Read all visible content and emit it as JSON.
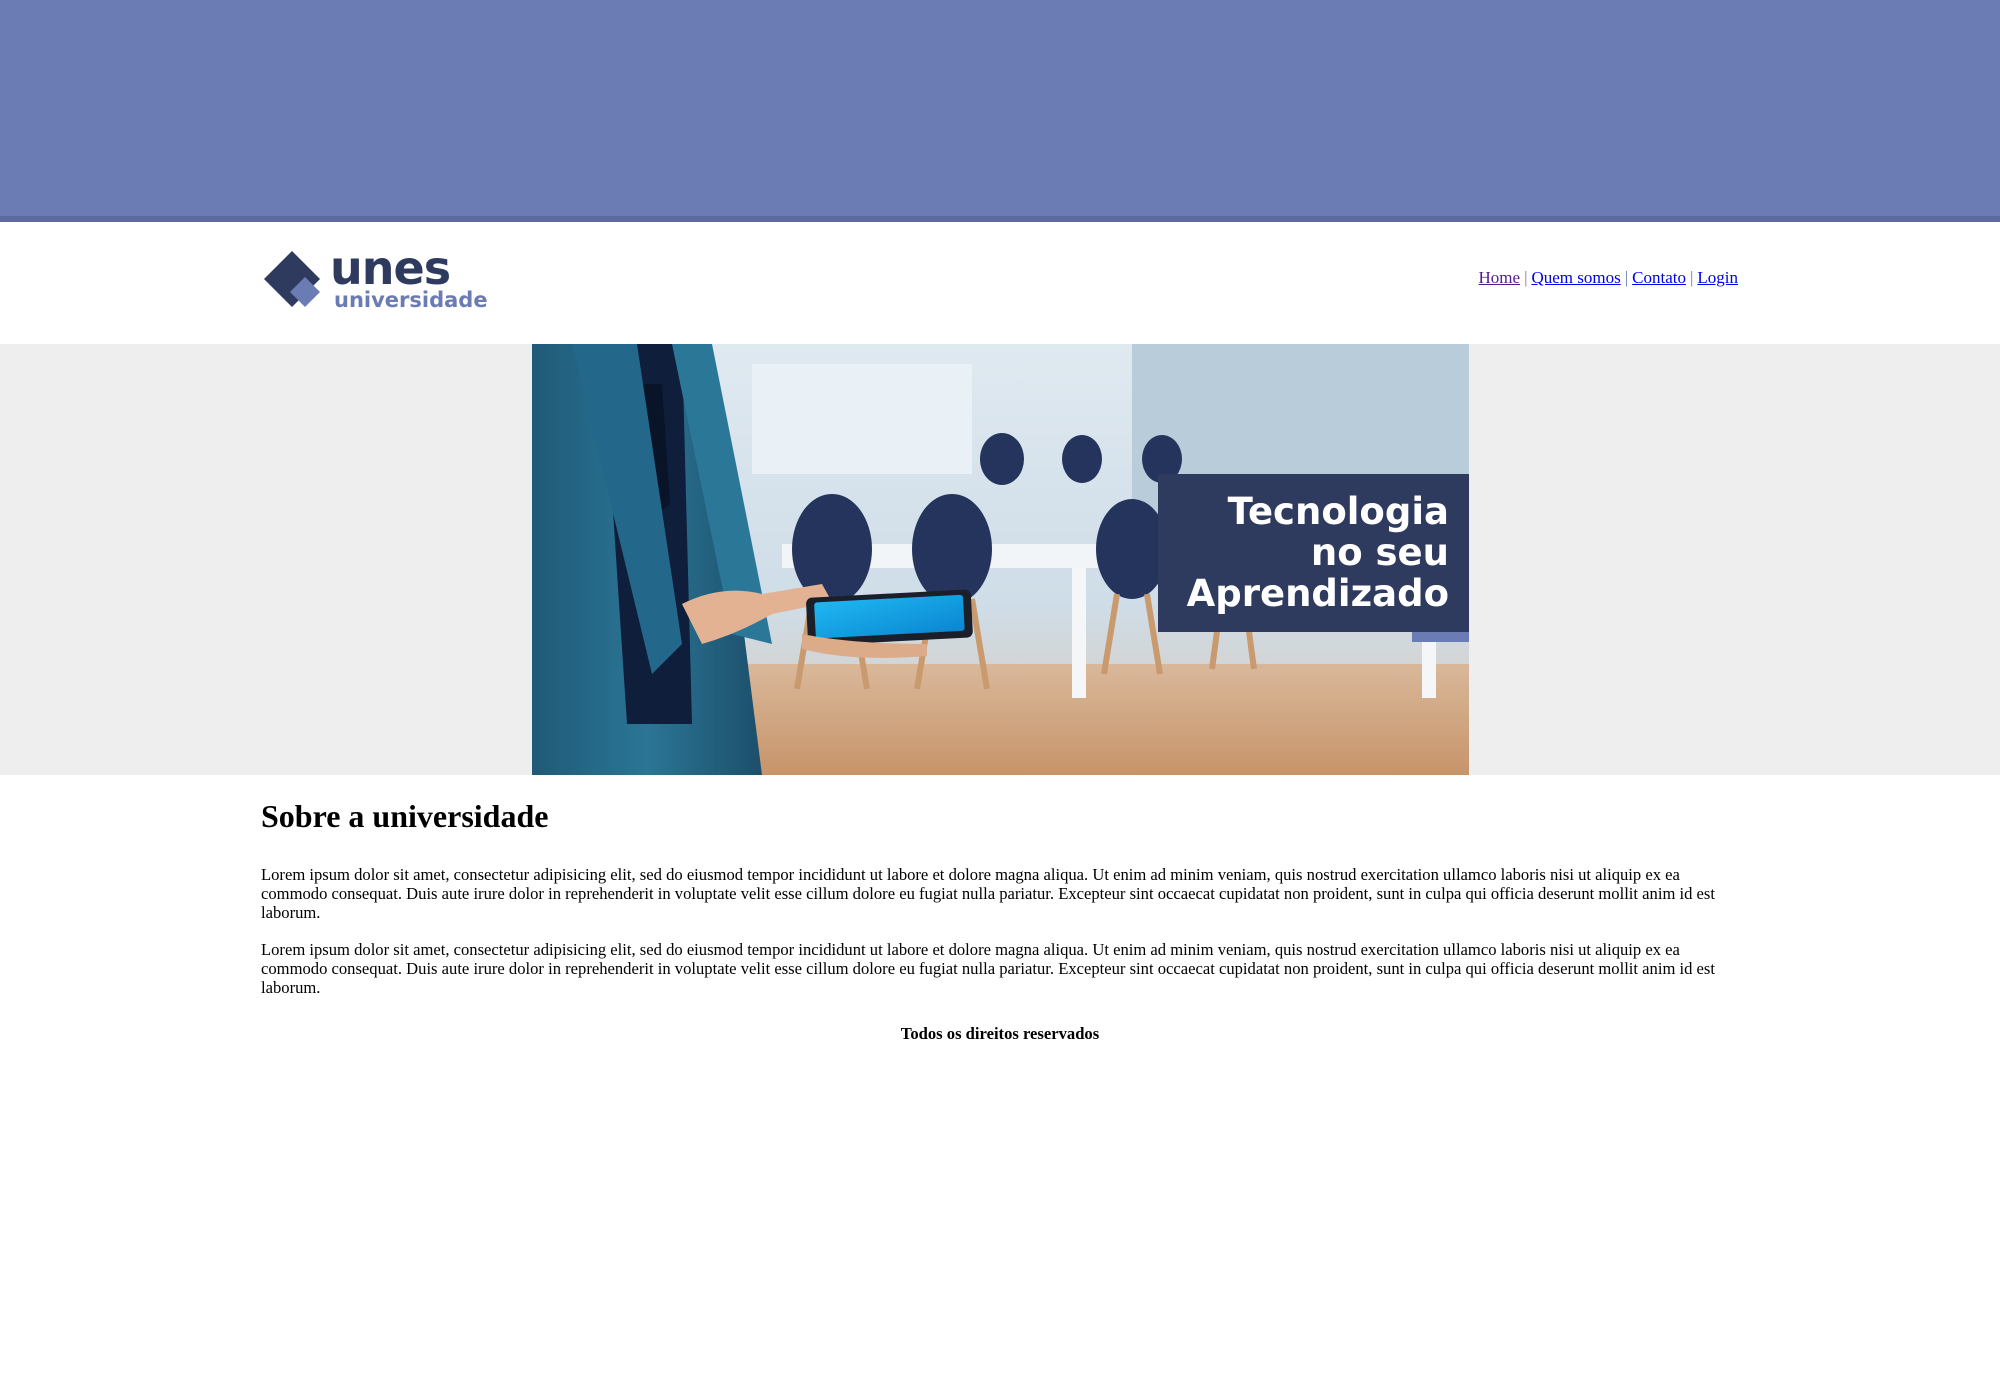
{
  "colors": {
    "topbar": "#6b7bb3",
    "brand_dark": "#2f3a5f",
    "brand_light": "#6b7bb3",
    "hero_bg": "#eeeeee"
  },
  "logo": {
    "name": "unes",
    "sub": "universidade"
  },
  "nav": {
    "items": [
      {
        "label": "Home"
      },
      {
        "label": "Quem somos"
      },
      {
        "label": "Contato"
      },
      {
        "label": "Login"
      }
    ],
    "separator": "|"
  },
  "banner": {
    "line1": "Tecnologia",
    "line2": "no seu",
    "line3": "Aprendizado"
  },
  "main": {
    "title": "Sobre a universidade",
    "paragraphs": [
      "Lorem ipsum dolor sit amet, consectetur adipisicing elit, sed do eiusmod tempor incididunt ut labore et dolore magna aliqua. Ut enim ad minim veniam, quis nostrud exercitation ullamco laboris nisi ut aliquip ex ea commodo consequat. Duis aute irure dolor in reprehenderit in voluptate velit esse cillum dolore eu fugiat nulla pariatur. Excepteur sint occaecat cupidatat non proident, sunt in culpa qui officia deserunt mollit anim id est laborum.",
      "Lorem ipsum dolor sit amet, consectetur adipisicing elit, sed do eiusmod tempor incididunt ut labore et dolore magna aliqua. Ut enim ad minim veniam, quis nostrud exercitation ullamco laboris nisi ut aliquip ex ea commodo consequat. Duis aute irure dolor in reprehenderit in voluptate velit esse cillum dolore eu fugiat nulla pariatur. Excepteur sint occaecat cupidatat non proident, sunt in culpa qui officia deserunt mollit anim id est laborum."
    ]
  },
  "footer": {
    "text": "Todos os direitos reservados"
  }
}
